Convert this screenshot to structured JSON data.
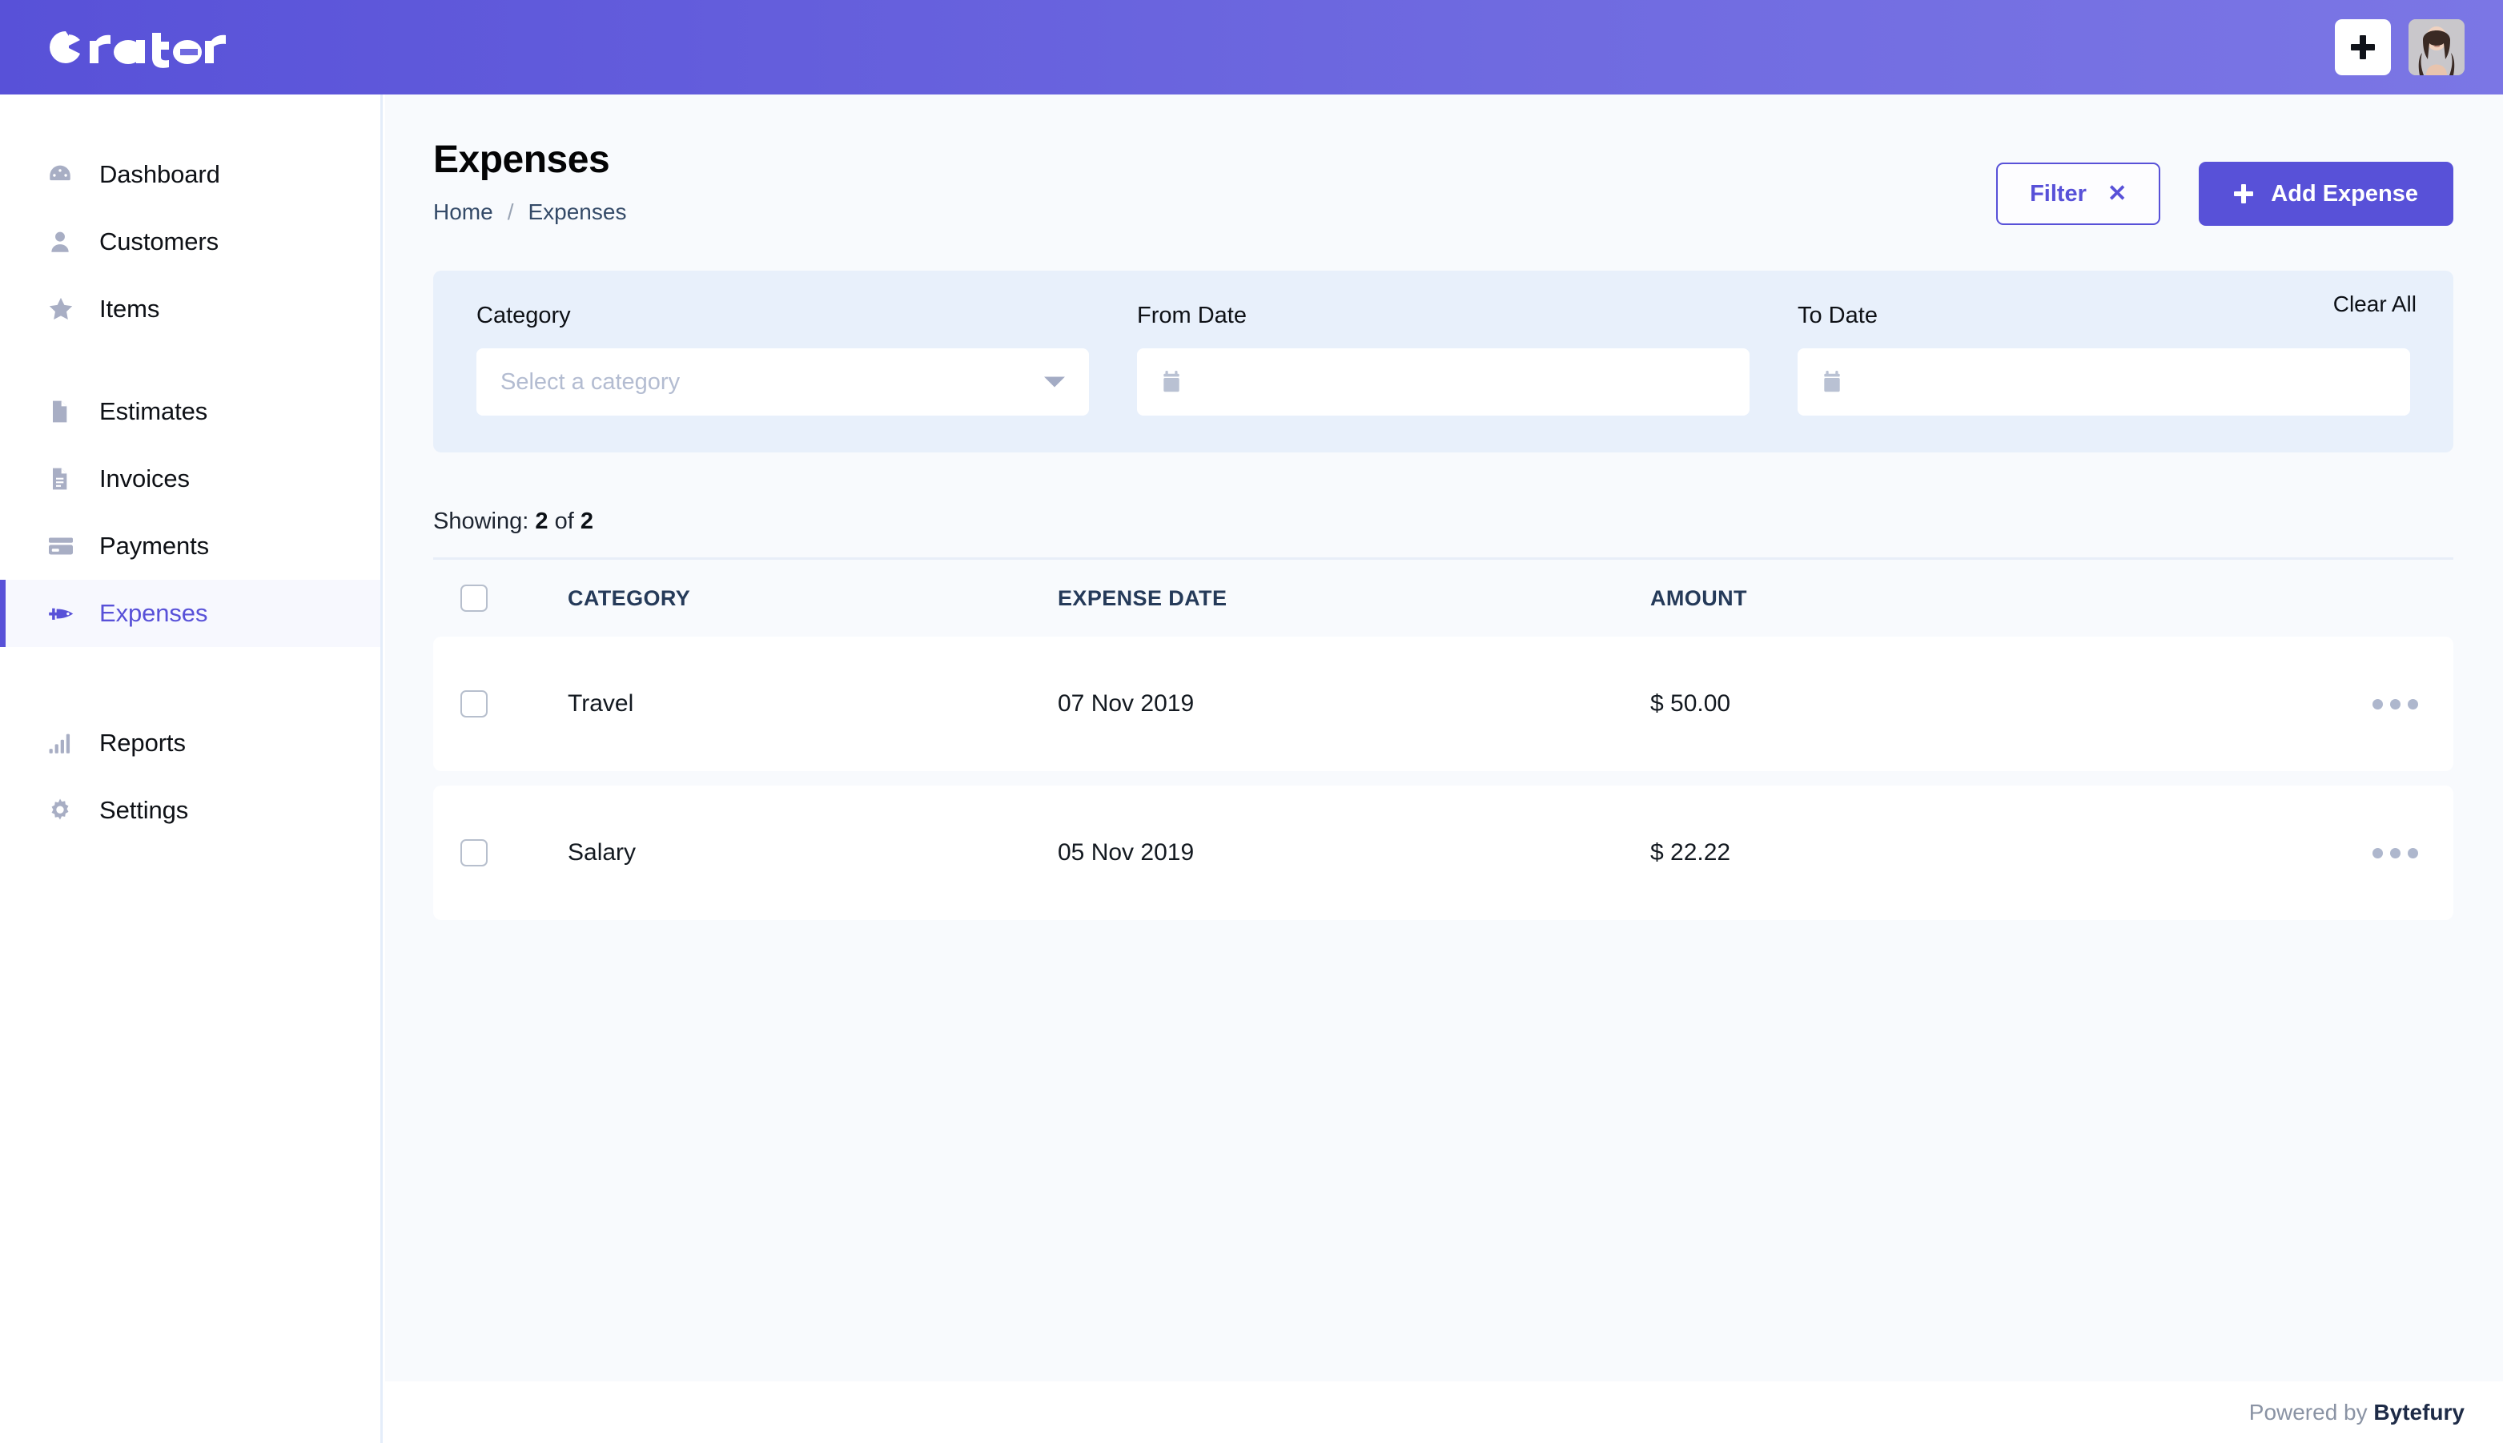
{
  "topbar": {
    "brand": "crater",
    "add_button": "+",
    "avatar_alt": "user-avatar"
  },
  "sidebar": {
    "groups": [
      {
        "items": [
          {
            "label": "Dashboard",
            "icon": "dashboard-icon",
            "active": false
          },
          {
            "label": "Customers",
            "icon": "user-icon",
            "active": false
          },
          {
            "label": "Items",
            "icon": "star-icon",
            "active": false
          }
        ]
      },
      {
        "items": [
          {
            "label": "Estimates",
            "icon": "document-icon",
            "active": false
          },
          {
            "label": "Invoices",
            "icon": "invoice-icon",
            "active": false
          },
          {
            "label": "Payments",
            "icon": "credit-card-icon",
            "active": false
          },
          {
            "label": "Expenses",
            "icon": "rocket-icon",
            "active": true
          }
        ]
      },
      {
        "items": [
          {
            "label": "Reports",
            "icon": "bar-chart-icon",
            "active": false
          },
          {
            "label": "Settings",
            "icon": "gear-icon",
            "active": false
          }
        ]
      }
    ]
  },
  "page": {
    "title": "Expenses",
    "breadcrumb": {
      "home": "Home",
      "separator": "/",
      "current": "Expenses"
    },
    "filter_button": "Filter",
    "filter_close_icon": "✕",
    "add_expense_button": "Add Expense"
  },
  "filters": {
    "clear_all": "Clear All",
    "category": {
      "label": "Category",
      "placeholder": "Select a category",
      "value": ""
    },
    "from_date": {
      "label": "From Date",
      "placeholder": "",
      "value": ""
    },
    "to_date": {
      "label": "To Date",
      "placeholder": "",
      "value": ""
    }
  },
  "table": {
    "showing_prefix": "Showing:",
    "showing_count": "2",
    "showing_of": "of",
    "showing_total": "2",
    "columns": {
      "category": "CATEGORY",
      "expense_date": "EXPENSE DATE",
      "amount": "AMOUNT"
    },
    "rows": [
      {
        "category": "Travel",
        "expense_date": "07 Nov 2019",
        "amount": "$ 50.00"
      },
      {
        "category": "Salary",
        "expense_date": "05 Nov 2019",
        "amount": "$ 22.22"
      }
    ]
  },
  "footer": {
    "powered_by": "Powered by ",
    "company": "Bytefury"
  },
  "colors": {
    "accent": "#5851d8",
    "header_gradient_start": "#5851d8",
    "header_gradient_end": "#7b76e5",
    "page_background": "#f8fafd",
    "filter_panel": "#e8f0fb"
  }
}
